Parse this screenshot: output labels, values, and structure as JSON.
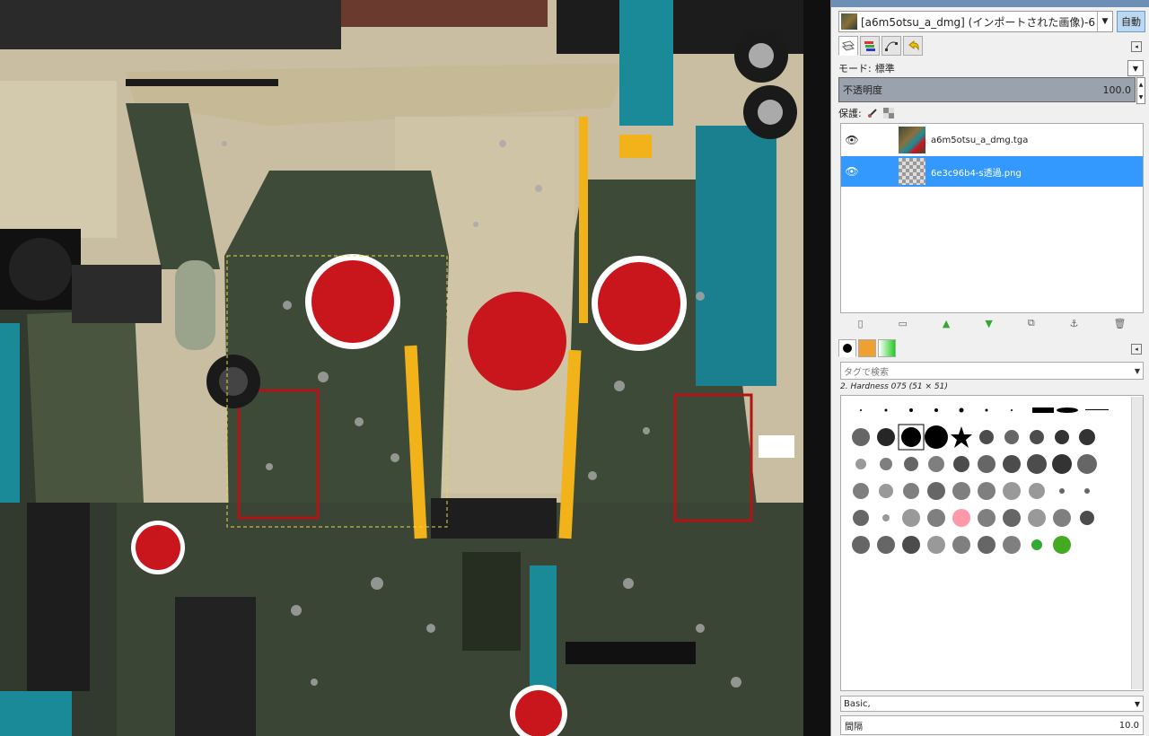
{
  "image_dock": {
    "image_name": "[a6m5otsu_a_dmg] (インポートされた画像)-6",
    "auto_button": "自動"
  },
  "layers_panel": {
    "mode_label": "モード:",
    "mode_value": "標準",
    "opacity_label": "不透明度",
    "opacity_value": "100.0",
    "lock_label": "保護:",
    "layers": [
      {
        "name": "a6m5otsu_a_dmg.tga",
        "visible": true,
        "selected": false
      },
      {
        "name": "6e3c96b4-s透過.png",
        "visible": true,
        "selected": true
      }
    ]
  },
  "brushes_panel": {
    "tag_search_placeholder": "タグで検索",
    "current_brush": "2. Hardness 075 (51 × 51)",
    "preset": "Basic,",
    "spacing_label": "間隔",
    "spacing_value": "10.0"
  },
  "colors": {
    "selection": "#3399ff",
    "panel_bg": "#f0f0f0",
    "roundel_red": "#c8161c",
    "airframe_green": "#3e4a38",
    "airframe_tan": "#c9bea1",
    "teal_parts": "#1a8a98",
    "yellow_stripe": "#f2b21a"
  },
  "icons": [
    "layers-tab-icon",
    "channels-tab-icon",
    "paths-tab-icon",
    "undo-tab-icon",
    "brush-lock-icon",
    "alpha-lock-icon",
    "eye-icon",
    "new-layer-icon",
    "new-group-icon",
    "raise-layer-icon",
    "lower-layer-icon",
    "duplicate-layer-icon",
    "anchor-icon",
    "delete-layer-icon",
    "brushes-tab-icon",
    "patterns-tab-icon",
    "gradients-tab-icon"
  ]
}
